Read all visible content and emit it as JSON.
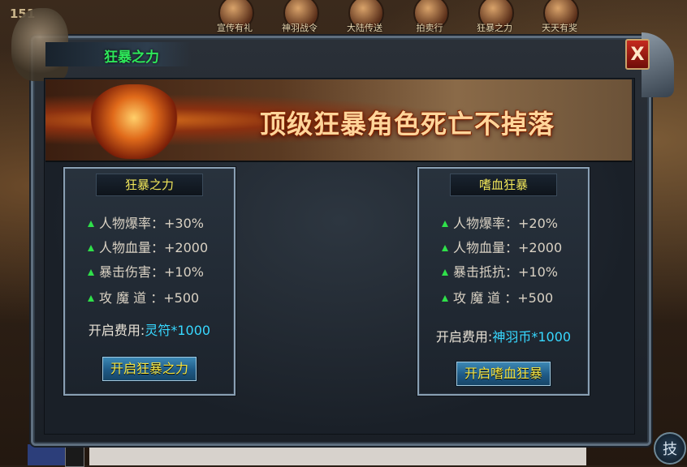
{
  "hud": {
    "level": "151",
    "top_icons": [
      "宣传有礼",
      "神羽战令",
      "大陆传送",
      "拍卖行",
      "狂暴之力",
      "天天有奖"
    ],
    "skill_button": "技"
  },
  "window": {
    "title": "狂暴之力",
    "close_label": "X",
    "banner_headline": "顶级狂暴角色死亡不掉落"
  },
  "panels": [
    {
      "title": "狂暴之力",
      "stats": [
        "人物爆率：+30%",
        "人物血量：+2000",
        "暴击伤害：+10%",
        "攻 魔 道 ：+500"
      ],
      "cost_label": "开启费用:",
      "cost_value": "灵符*1000",
      "button_label": "开启狂暴之力"
    },
    {
      "title": "嗜血狂暴",
      "stats": [
        "人物爆率：+20%",
        "人物血量：+2000",
        "暴击抵抗：+10%",
        "攻 魔 道 ：+500"
      ],
      "cost_label": "开启费用:",
      "cost_value": "神羽币*1000",
      "button_label": "开启嗜血狂暴"
    }
  ],
  "colors": {
    "title_green": "#2ee85a",
    "panel_title_yellow": "#f1e65a",
    "currency_cyan": "#37d8ff",
    "stat_arrow_green": "#2fe04a",
    "button_blue": "#2a6f9c"
  }
}
